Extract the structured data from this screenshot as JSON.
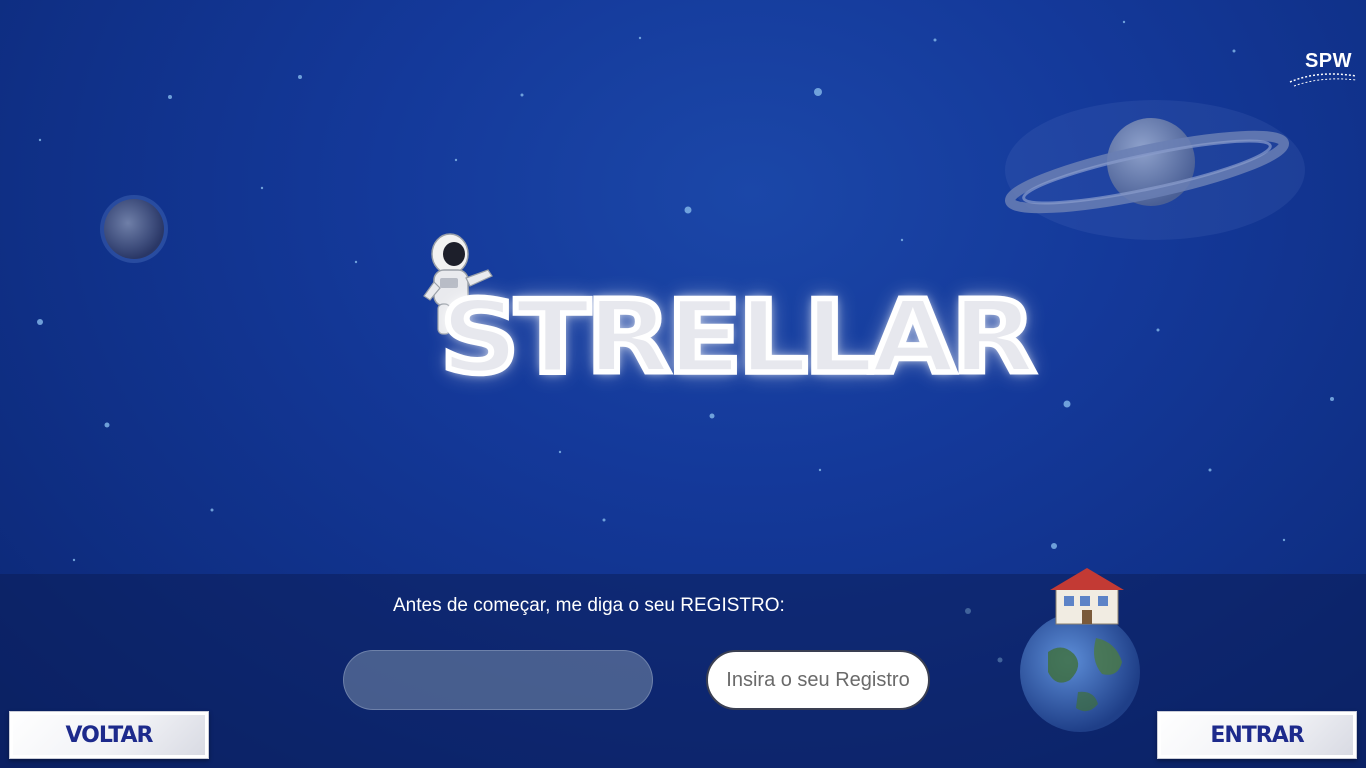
{
  "brand": {
    "label": "SPW"
  },
  "logo": {
    "title": "STRELLAR"
  },
  "login": {
    "prompt": "Antes de começar, me diga o seu REGISTRO:",
    "register_value": "",
    "register_hint": "Insira o seu Registro"
  },
  "actions": {
    "back_label": "VOLTAR",
    "enter_label": "ENTRAR"
  },
  "colors": {
    "space_background": "#14399a",
    "button_text": "#1d2a8c",
    "panel_overlay": "#0a1a50"
  },
  "icons": [
    "planet-icon",
    "saturn-icon",
    "astronaut-icon",
    "earth-house-icon"
  ]
}
